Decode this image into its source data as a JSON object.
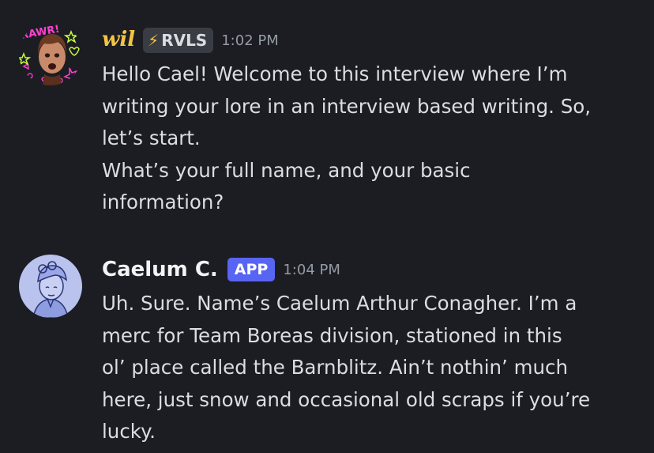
{
  "messages": [
    {
      "author": "wil",
      "tag_text": "RVLS",
      "tag_icon": "lightning-bolt-icon",
      "timestamp": "1:02 PM",
      "avatar_icon": "rawr-sticker-avatar",
      "avatar_text": "RAWR!",
      "lines": [
        "Hello Cael! Welcome to this interview where I’m",
        "writing your lore in an interview based writing. So,",
        "let’s start.",
        "What’s your full name, and your basic",
        "information?"
      ]
    },
    {
      "author": "Caelum C.",
      "badge": "APP",
      "timestamp": "1:04 PM",
      "avatar_icon": "sketch-portrait-avatar",
      "lines": [
        "Uh. Sure. Name’s Caelum Arthur Conagher. I’m a",
        "merc for Team Boreas division, stationed in this",
        "ol’ place called the Barnblitz. Ain’t nothin’ much",
        "here, just snow and occasional old scraps if you’re",
        "lucky."
      ]
    }
  ],
  "colors": {
    "background": "#1c1d23",
    "author1": "#f5c542",
    "author2": "#f2f3f5",
    "app_badge": "#5865f2",
    "timestamp": "#949ba4",
    "text": "#dbdee1"
  }
}
